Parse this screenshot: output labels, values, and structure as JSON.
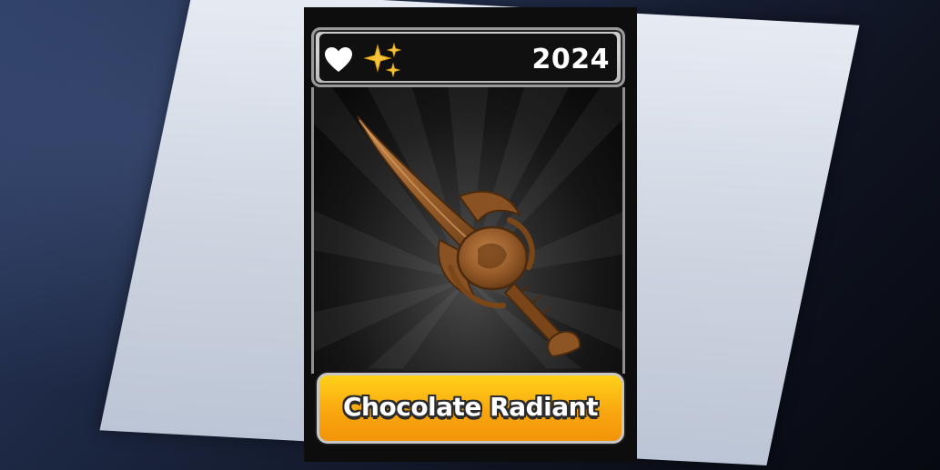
{
  "card": {
    "year": "2024",
    "item_name": "Chocolate Radiant",
    "icons": [
      "heart-icon",
      "sparkle-icon"
    ],
    "colors": {
      "name_plate": "#f9a70f",
      "weapon": "#8b5a2b",
      "header_frame": "#c9c9c9",
      "art_background": "#1a1a1a"
    }
  }
}
